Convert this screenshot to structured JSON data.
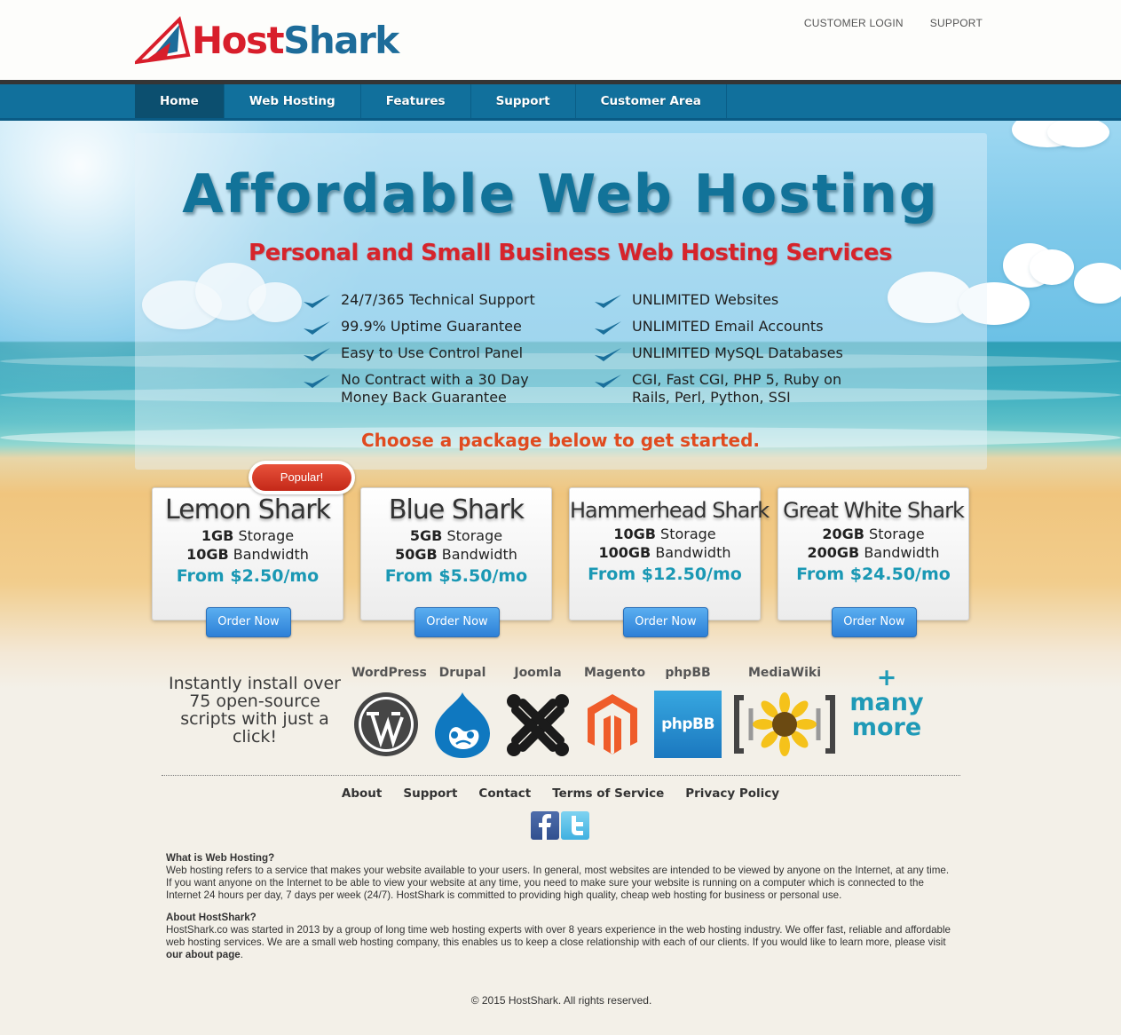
{
  "header": {
    "logo_host": "Host",
    "logo_shark": "Shark",
    "top_links": [
      "CUSTOMER LOGIN",
      "SUPPORT"
    ]
  },
  "nav": {
    "items": [
      {
        "label": "Home",
        "active": true
      },
      {
        "label": "Web Hosting",
        "active": false
      },
      {
        "label": "Features",
        "active": false
      },
      {
        "label": "Support",
        "active": false
      },
      {
        "label": "Customer Area",
        "active": false
      }
    ]
  },
  "hero": {
    "title": "Affordable Web Hosting",
    "subtitle": "Personal and Small Business Web Hosting Services",
    "features_left": [
      "24/7/365 Technical Support",
      "99.9% Uptime Guarantee",
      "Easy to Use Control Panel",
      "No Contract with a 30 Day\nMoney Back Guarantee"
    ],
    "features_right": [
      "UNLIMITED Websites",
      "UNLIMITED Email Accounts",
      "UNLIMITED MySQL Databases",
      "CGI, Fast CGI, PHP 5, Ruby on\nRails, Perl, Python, SSI"
    ],
    "cta": "Choose a package below to get started.",
    "check_color": "#1a6f9b"
  },
  "popular_badge": "Popular!",
  "packages": [
    {
      "name": "Lemon Shark",
      "storage_amount": "1GB",
      "storage_label": "Storage",
      "bandwidth_amount": "10GB",
      "bandwidth_label": "Bandwidth",
      "price": "From $2.50/mo",
      "button": "Order Now"
    },
    {
      "name": "Blue Shark",
      "storage_amount": "5GB",
      "storage_label": "Storage",
      "bandwidth_amount": "50GB",
      "bandwidth_label": "Bandwidth",
      "price": "From $5.50/mo",
      "button": "Order Now"
    },
    {
      "name": "Hammerhead Shark",
      "storage_amount": "10GB",
      "storage_label": "Storage",
      "bandwidth_amount": "100GB",
      "bandwidth_label": "Bandwidth",
      "price": "From $12.50/mo",
      "button": "Order Now"
    },
    {
      "name": "Great White Shark",
      "storage_amount": "20GB",
      "storage_label": "Storage",
      "bandwidth_amount": "200GB",
      "bandwidth_label": "Bandwidth",
      "price": "From $24.50/mo",
      "button": "Order Now"
    }
  ],
  "scripts": {
    "intro": "Instantly install over 75 open-source scripts with just a click!",
    "items": [
      {
        "name": "WordPress",
        "icon": "wordpress-icon"
      },
      {
        "name": "Drupal",
        "icon": "drupal-icon"
      },
      {
        "name": "Joomla",
        "icon": "joomla-icon"
      },
      {
        "name": "Magento",
        "icon": "magento-icon"
      },
      {
        "name": "phpBB",
        "icon": "phpbb-icon"
      },
      {
        "name": "MediaWiki",
        "icon": "mediawiki-icon"
      }
    ],
    "phpbb_logo_text": "phpBB",
    "more_plus": "+",
    "more_text": "many more"
  },
  "footer": {
    "links": [
      "About",
      "Support",
      "Contact",
      "Terms of Service",
      "Privacy Policy"
    ],
    "social": [
      "facebook-icon",
      "twitter-icon"
    ],
    "what_title": "What is Web Hosting?",
    "what_body": "Web hosting refers to a service that makes your website available to your users. In general, most websites are intended to be viewed by anyone on the Internet, at any time. If you want anyone on the Internet to be able to view your website at any time, you need to make sure your website is running on a computer which is connected to the Internet 24 hours per day, 7 days per week (24/7). HostShark is committed to providing high quality, cheap web hosting for business or personal use.",
    "about_title": "About HostShark?",
    "about_body": "HostShark.co was started in 2013 by a group of long time web hosting experts with over 8 years experience in the web hosting industry. We offer fast, reliable and affordable web hosting services. We are a small web hosting company, this enables us to keep a close relationship with each of our clients. If you would like to learn more, please visit ",
    "about_link": "our about page",
    "about_end": ".",
    "copyright": "© 2015 HostShark. All rights reserved."
  },
  "colors": {
    "nav_bg": "#11709c",
    "nav_active": "#0c4f6f",
    "title_blue": "#127399",
    "subtitle_red": "#d6242b",
    "cta_orange": "#e04b1f",
    "price_teal": "#1a98b4",
    "button_blue": "#2d80d7"
  }
}
